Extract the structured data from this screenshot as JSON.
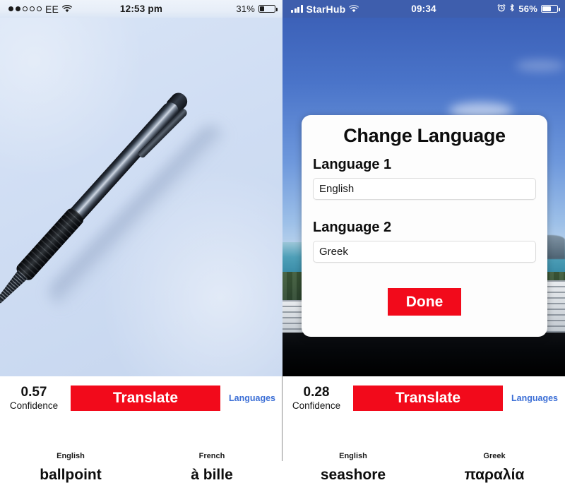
{
  "left": {
    "status_bar": {
      "signal_dots_filled": 2,
      "signal_dots_total": 5,
      "carrier": "EE",
      "wifi_icon": "wifi-icon",
      "time": "12:53 pm",
      "battery_percent": "31%",
      "battery_level": 31
    },
    "photo": {
      "subject": "ballpoint-pen-on-blue-paper"
    },
    "controls": {
      "confidence_value": "0.57",
      "confidence_label": "Confidence",
      "translate_label": "Translate",
      "languages_label": "Languages"
    },
    "results": [
      {
        "language": "English",
        "word": "ballpoint"
      },
      {
        "language": "French",
        "word": "à bille"
      }
    ]
  },
  "right": {
    "status_bar": {
      "signal_icon": "signal-bars-icon",
      "carrier": "StarHub",
      "wifi_icon": "wifi-icon",
      "time": "09:34",
      "alarm_icon": "alarm-clock-icon",
      "bluetooth_icon": "bluetooth-icon",
      "battery_percent": "56%",
      "battery_level": 56
    },
    "photo": {
      "subject": "seashore-from-high-window"
    },
    "dialog": {
      "title": "Change Language",
      "fields": [
        {
          "label": "Language 1",
          "value": "English"
        },
        {
          "label": "Language 2",
          "value": "Greek"
        }
      ],
      "done_label": "Done"
    },
    "controls": {
      "confidence_value": "0.28",
      "confidence_label": "Confidence",
      "translate_label": "Translate",
      "languages_label": "Languages"
    },
    "results": [
      {
        "language": "English",
        "word": "seashore"
      },
      {
        "language": "Greek",
        "word": "παραλία"
      }
    ]
  },
  "colors": {
    "accent_red": "#f20a1b",
    "link_blue": "#3c6fd6",
    "right_status_bar": "#3e5ead"
  }
}
